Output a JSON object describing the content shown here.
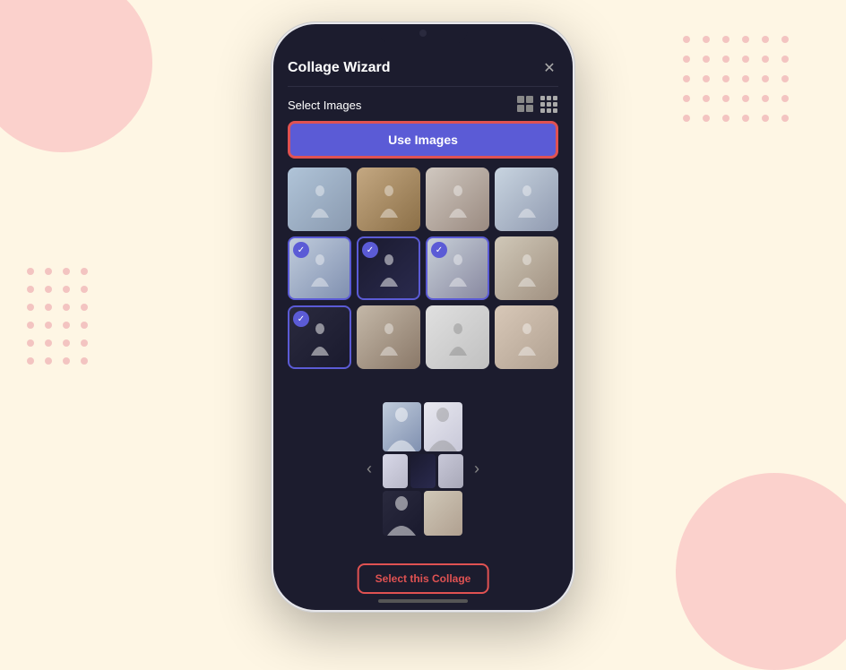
{
  "background": {
    "color": "#fef6e4",
    "blob_color": "#f9c2c2",
    "dot_color": "#f0b8b8"
  },
  "app": {
    "title": "Collage Wizard",
    "close_label": "✕"
  },
  "toolbar": {
    "select_images_label": "Select Images"
  },
  "buttons": {
    "use_images_label": "Use Images",
    "select_collage_label": "Select this Collage"
  },
  "carousel": {
    "prev_arrow": "‹",
    "next_arrow": "›"
  },
  "images": [
    {
      "id": 1,
      "selected": false,
      "color_class": "p1"
    },
    {
      "id": 2,
      "selected": false,
      "color_class": "p2"
    },
    {
      "id": 3,
      "selected": false,
      "color_class": "p3"
    },
    {
      "id": 4,
      "selected": false,
      "color_class": "p4"
    },
    {
      "id": 5,
      "selected": true,
      "color_class": "p5"
    },
    {
      "id": 6,
      "selected": true,
      "color_class": "p6"
    },
    {
      "id": 7,
      "selected": true,
      "color_class": "p7"
    },
    {
      "id": 8,
      "selected": false,
      "color_class": "p8"
    },
    {
      "id": 9,
      "selected": true,
      "color_class": "p9"
    },
    {
      "id": 10,
      "selected": false,
      "color_class": "p10"
    },
    {
      "id": 11,
      "selected": false,
      "color_class": "p11"
    },
    {
      "id": 12,
      "selected": false,
      "color_class": "p12"
    }
  ]
}
